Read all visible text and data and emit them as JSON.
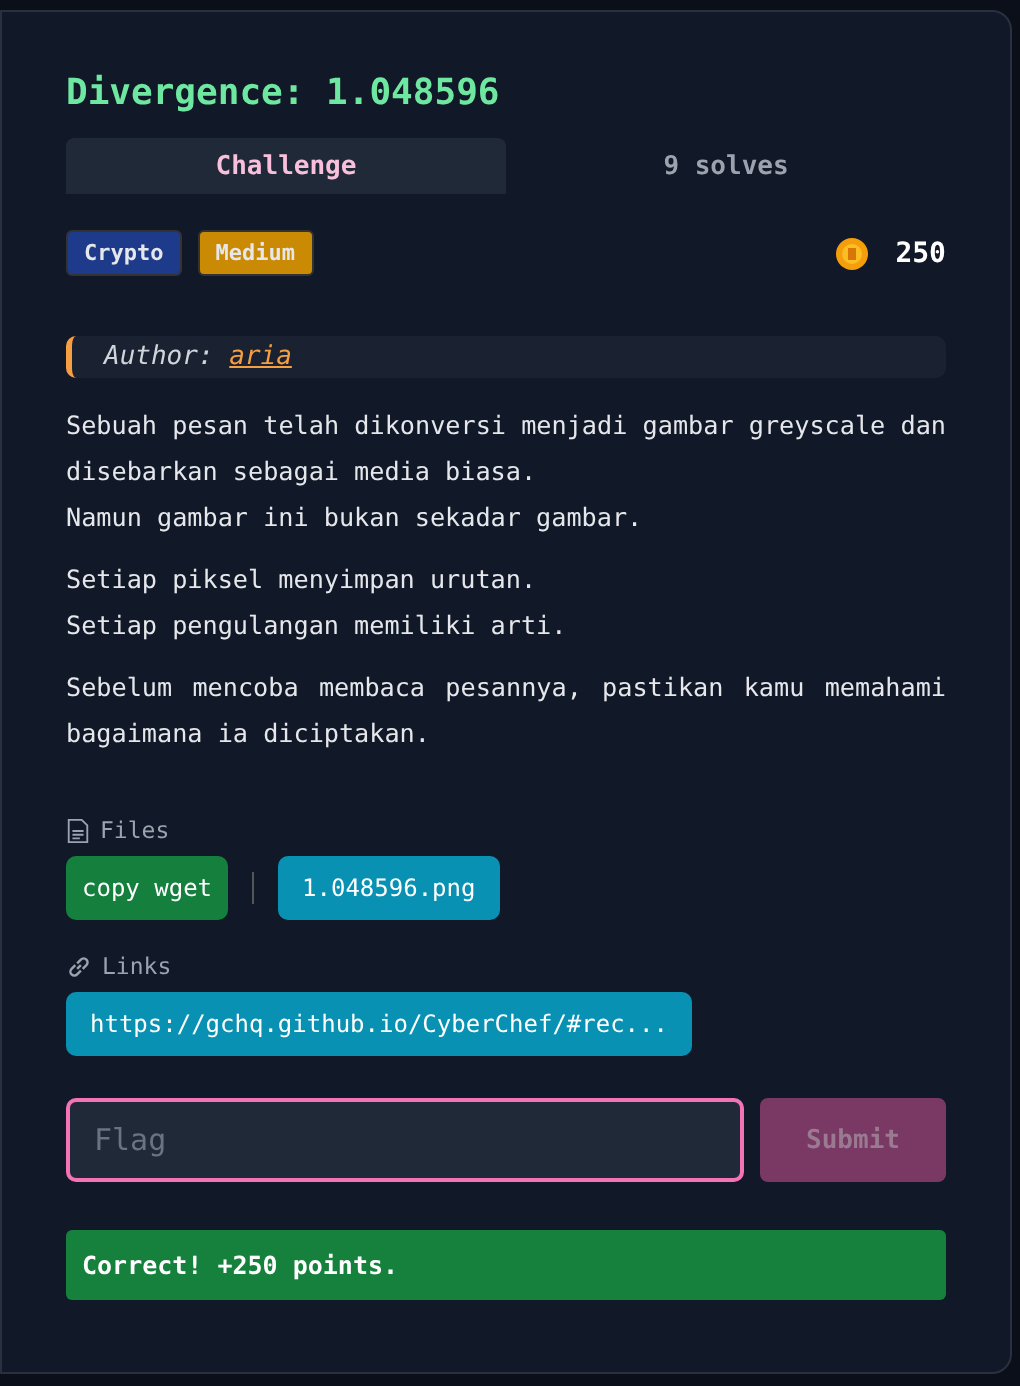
{
  "title": "Divergence: 1.048596",
  "tabs": [
    {
      "label": "Challenge",
      "selected": true
    },
    {
      "label": "9 solves",
      "selected": false
    }
  ],
  "tags": [
    {
      "label": "Crypto",
      "color": "#1e3a8a"
    },
    {
      "label": "Medium",
      "color": "#ca8a04"
    }
  ],
  "points": "250",
  "author": {
    "label": "Author:",
    "name": "aria"
  },
  "paragraphs": [
    "Sebuah pesan telah dikonversi menjadi gambar greyscale dan disebarkan sebagai media biasa.\nNamun gambar ini bukan sekadar gambar.",
    "Setiap piksel menyimpan urutan.\nSetiap pengulangan memiliki arti.",
    "Sebelum mencoba membaca pesannya, pastikan kamu memahami bagaimana ia diciptakan."
  ],
  "files": {
    "label": "Files",
    "copy_button": "copy wget",
    "items": [
      "1.048596.png"
    ]
  },
  "links": {
    "label": "Links",
    "items": [
      "https://gchq.github.io/CyberChef/#rec..."
    ]
  },
  "flag": {
    "placeholder": "Flag",
    "focused": true
  },
  "submit": {
    "label": "Submit",
    "disabled": true
  },
  "result": {
    "text": "Correct! +250 points.",
    "kind": "success"
  }
}
